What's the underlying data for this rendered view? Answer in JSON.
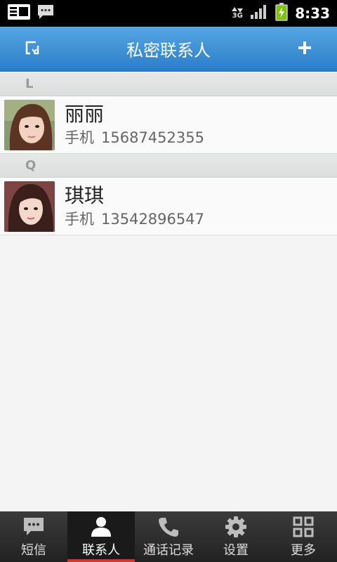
{
  "status_bar": {
    "time": "8:33",
    "network_label": "3G",
    "icons": [
      "news-icon",
      "sms-notification-icon",
      "data-transfer-icon",
      "signal-icon",
      "battery-charging-icon"
    ]
  },
  "title_bar": {
    "title": "私密联系人",
    "left_icon": "import-icon",
    "right_icon": "add-icon",
    "color": "#3b8fd6"
  },
  "sections": [
    {
      "letter": "L",
      "contacts": [
        {
          "name": "丽丽",
          "phone_label": "手机",
          "phone": "15687452355"
        }
      ]
    },
    {
      "letter": "Q",
      "contacts": [
        {
          "name": "琪琪",
          "phone_label": "手机",
          "phone": "13542896547"
        }
      ]
    }
  ],
  "bottom_nav": {
    "items": [
      {
        "label": "短信",
        "icon": "message-icon",
        "active": false
      },
      {
        "label": "联系人",
        "icon": "contact-icon",
        "active": true
      },
      {
        "label": "通话记录",
        "icon": "phone-icon",
        "active": false
      },
      {
        "label": "设置",
        "icon": "gear-icon",
        "active": false
      },
      {
        "label": "更多",
        "icon": "grid-icon",
        "active": false
      }
    ],
    "active_indicator_color": "#d9332b"
  }
}
